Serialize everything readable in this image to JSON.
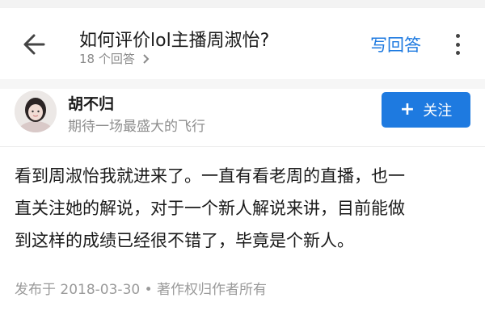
{
  "header": {
    "question_title": "如何评价lol主播周淑怡?",
    "answer_count": "18 个回答",
    "write_answer_label": "写回答",
    "accent_color": "#1e7ae0"
  },
  "author": {
    "name": "胡不归",
    "bio": "期待一场最盛大的飞行",
    "follow_label": "关注"
  },
  "answer": {
    "lines": [
      "看到周淑怡我就进来了。一直有看老周的直播，也一",
      "直关注她的解说，对于一个新人解说来讲，目前能做",
      "到这样的成绩已经很不错了，毕竟是个新人。"
    ],
    "meta": "发布于 2018-03-30 • 著作权归作者所有"
  },
  "icons": {
    "back": "arrow-left-icon",
    "answers_chevron": "chevron-right-icon",
    "more": "more-vertical-icon",
    "follow": "plus-icon"
  }
}
